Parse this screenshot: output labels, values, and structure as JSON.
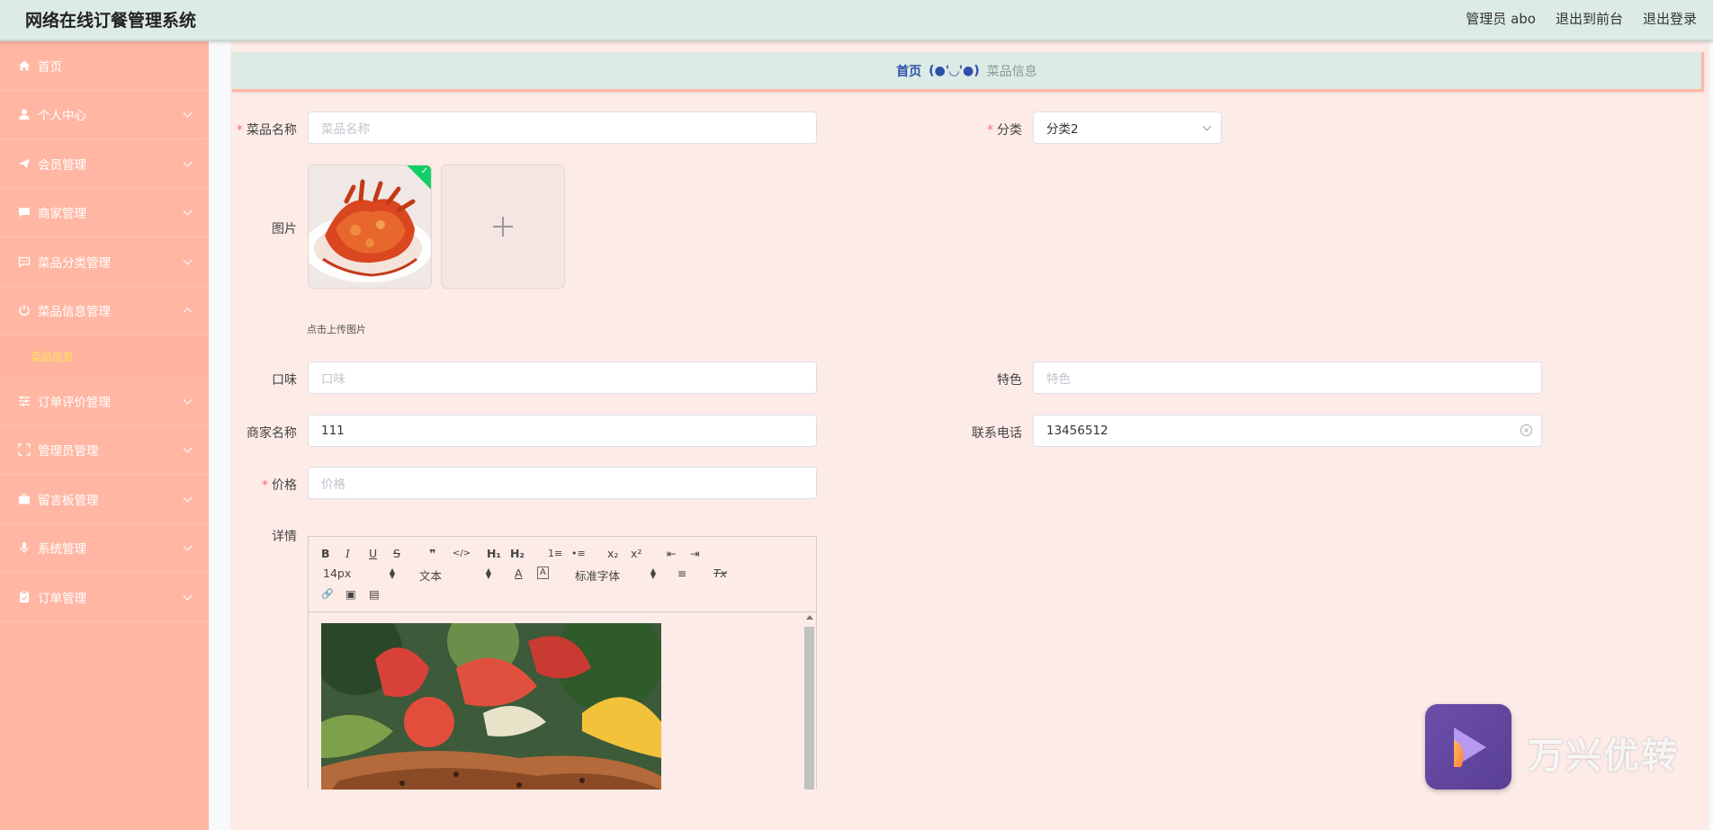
{
  "header": {
    "title": "网络在线订餐管理系统",
    "user": "管理员 abo",
    "to_front": "退出到前台",
    "logout": "退出登录"
  },
  "sidebar": {
    "items": [
      {
        "label": "首页",
        "icon": "home-icon"
      },
      {
        "label": "个人中心",
        "icon": "user-icon"
      },
      {
        "label": "会员管理",
        "icon": "send-icon"
      },
      {
        "label": "商家管理",
        "icon": "message-icon"
      },
      {
        "label": "菜品分类管理",
        "icon": "chat-icon"
      },
      {
        "label": "菜品信息管理",
        "icon": "power-icon"
      },
      {
        "label": "订单评价管理",
        "icon": "sliders-icon"
      },
      {
        "label": "管理员管理",
        "icon": "fullscreen-icon"
      },
      {
        "label": "留言板管理",
        "icon": "briefcase-icon"
      },
      {
        "label": "系统管理",
        "icon": "microphone-icon"
      },
      {
        "label": "订单管理",
        "icon": "clipboard-icon"
      }
    ],
    "sub_item": "菜品信息"
  },
  "breadcrumb": {
    "home": "首页",
    "separator": "(●'◡'●)",
    "current": "菜品信息"
  },
  "form": {
    "dish_name": {
      "label": "菜品名称",
      "value": "",
      "placeholder": "菜品名称"
    },
    "category": {
      "label": "分类",
      "value": "分类2"
    },
    "image": {
      "label": "图片",
      "tip": "点击上传图片"
    },
    "taste": {
      "label": "口味",
      "value": "",
      "placeholder": "口味"
    },
    "feature": {
      "label": "特色",
      "value": "",
      "placeholder": "特色"
    },
    "merchant": {
      "label": "商家名称",
      "value": "111"
    },
    "phone": {
      "label": "联系电话",
      "value": "13456512"
    },
    "price": {
      "label": "价格",
      "value": "",
      "placeholder": "价格"
    },
    "detail": {
      "label": "详情"
    }
  },
  "editor": {
    "bold": "B",
    "italic": "I",
    "underline": "U",
    "strike": "S",
    "quote": "❞",
    "code": "</>",
    "h1": "H₁",
    "h2": "H₂",
    "ol": "1≡",
    "ul": "•≡",
    "sub": "x₂",
    "sup": "x²",
    "outdent": "⇤",
    "indent": "⇥",
    "size": "14px",
    "header": "文本",
    "color": "A",
    "bg": "A",
    "font": "标准字体",
    "align": "≡",
    "clean": "Tx",
    "link": "🔗",
    "image": "▣",
    "video": "▤"
  },
  "watermark": "万兴优转"
}
